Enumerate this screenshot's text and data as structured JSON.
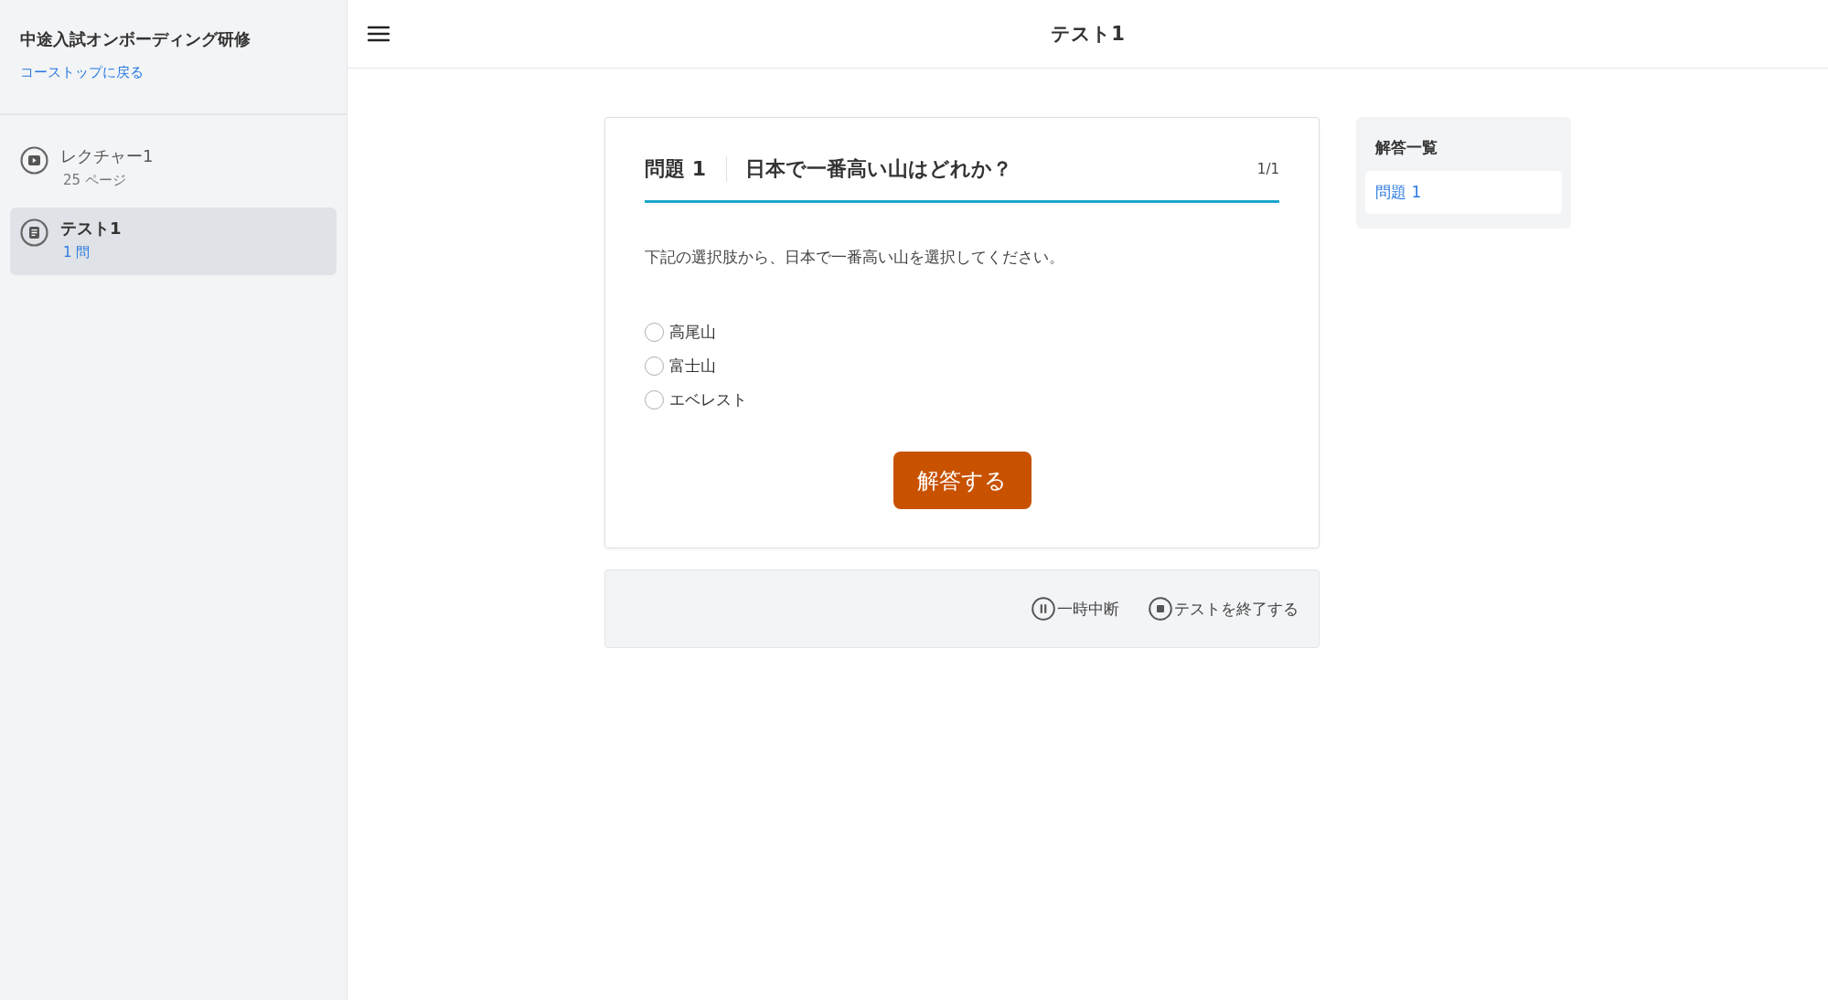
{
  "sidebar": {
    "course_title": "中途入試オンボーディング研修",
    "back_link": "コーストップに戻る",
    "items": [
      {
        "kind": "lecture",
        "title": "レクチャー1",
        "meta": "25 ページ",
        "selected": false
      },
      {
        "kind": "test",
        "title": "テスト1",
        "meta": "1 問",
        "selected": true
      }
    ]
  },
  "header": {
    "title": "テスト1"
  },
  "question": {
    "label": "問題 1",
    "title": "日本で一番高い山はどれか？",
    "counter": "1/1",
    "instruction": "下記の選択肢から、日本で一番高い山を選択してください。",
    "options": [
      {
        "label": "高尾山",
        "selected": false
      },
      {
        "label": "富士山",
        "selected": false
      },
      {
        "label": "エベレスト",
        "selected": false
      }
    ],
    "submit_button": "解答する"
  },
  "controls": [
    {
      "kind": "pause",
      "label": "一時中断"
    },
    {
      "kind": "stop",
      "label": "テストを終了する"
    }
  ],
  "answer_list": {
    "title": "解答一覧",
    "items": [
      {
        "label": "問題 1",
        "selected": true
      }
    ]
  }
}
